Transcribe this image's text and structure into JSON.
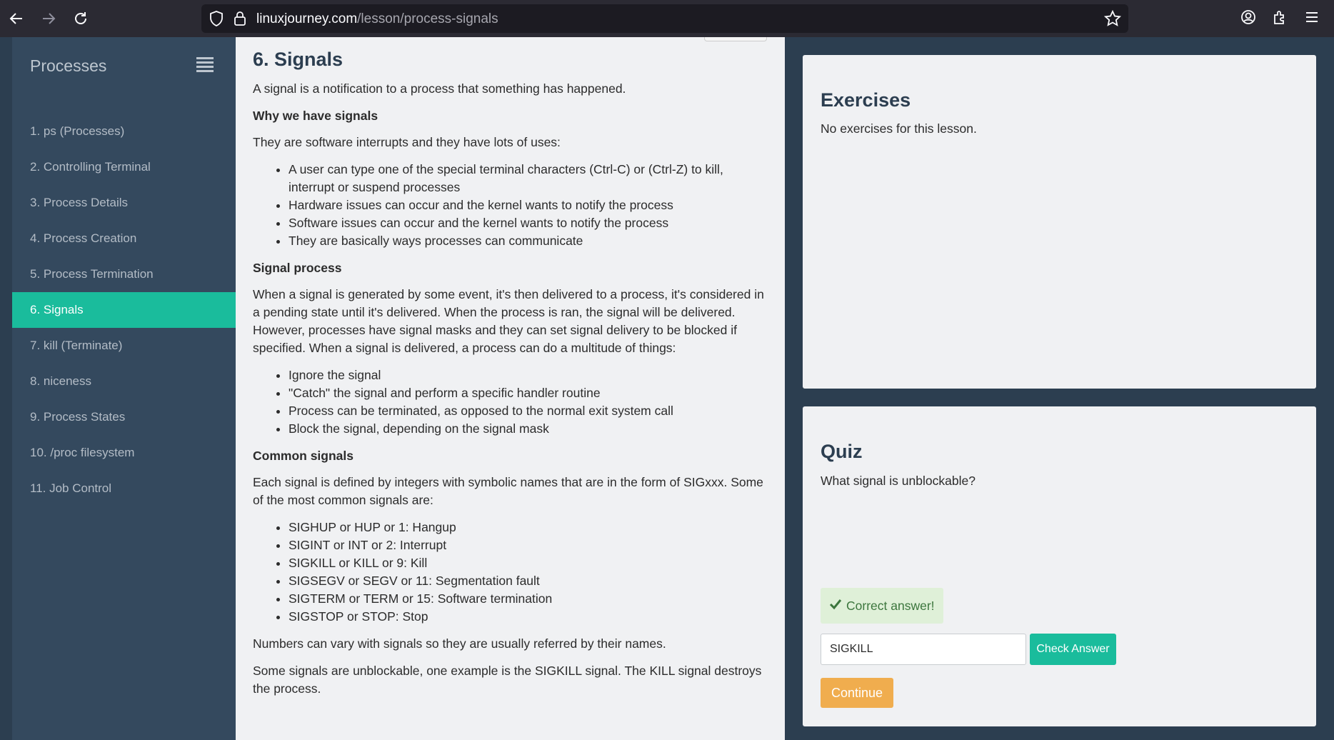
{
  "browser": {
    "url_domain": "linuxjourney.com",
    "url_path": "/lesson/process-signals",
    "icons": [
      "back-arrow-icon",
      "forward-arrow-icon",
      "reload-icon",
      "shield-icon",
      "lock-icon",
      "star-icon",
      "account-icon",
      "extensions-icon",
      "menu-icon"
    ]
  },
  "sidebar": {
    "title": "Processes",
    "items": [
      {
        "label": "1. ps (Processes)"
      },
      {
        "label": "2. Controlling Terminal"
      },
      {
        "label": "3. Process Details"
      },
      {
        "label": "4. Process Creation"
      },
      {
        "label": "5. Process Termination"
      },
      {
        "label": "6. Signals",
        "active": true
      },
      {
        "label": "7. kill (Terminate)"
      },
      {
        "label": "8. niceness"
      },
      {
        "label": "9. Process States"
      },
      {
        "label": "10. /proc filesystem"
      },
      {
        "label": "11. Job Control"
      }
    ]
  },
  "lesson": {
    "title": "6. Signals",
    "intro": "A signal is a notification to a process that something has happened.",
    "why_heading": "Why we have signals",
    "why_text": "They are software interrupts and they have lots of uses:",
    "why_list": [
      "A user can type one of the special terminal characters (Ctrl-C) or (Ctrl-Z) to kill, interrupt or suspend processes",
      "Hardware issues can occur and the kernel wants to notify the process",
      "Software issues can occur and the kernel wants to notify the process",
      "They are basically ways processes can communicate"
    ],
    "process_heading": "Signal process",
    "process_text": "When a signal is generated by some event, it's then delivered to a process, it's considered in a pending state until it's delivered. When the process is ran, the signal will be delivered. However, processes have signal masks and they can set signal delivery to be blocked if specified. When a signal is delivered, a process can do a multitude of things:",
    "process_list": [
      "Ignore the signal",
      "\"Catch\" the signal and perform a specific handler routine",
      "Process can be terminated, as opposed to the normal exit system call",
      "Block the signal, depending on the signal mask"
    ],
    "common_heading": "Common signals",
    "common_text": "Each signal is defined by integers with symbolic names that are in the form of SIGxxx. Some of the most common signals are:",
    "common_list": [
      "SIGHUP or HUP or 1: Hangup",
      "SIGINT or INT or 2: Interrupt",
      "SIGKILL or KILL or 9: Kill",
      "SIGSEGV or SEGV or 11: Segmentation fault",
      "SIGTERM or TERM or 15: Software termination",
      "SIGSTOP or STOP: Stop"
    ],
    "numbers_text": "Numbers can vary with signals so they are usually referred by their names.",
    "unblockable_text": "Some signals are unblockable, one example is the SIGKILL signal. The KILL signal destroys the process."
  },
  "exercises": {
    "title": "Exercises",
    "text": "No exercises for this lesson."
  },
  "quiz": {
    "title": "Quiz",
    "question": "What signal is unblockable?",
    "feedback": "Correct answer!",
    "answer_value": "SIGKILL",
    "check_label": "Check Answer",
    "continue_label": "Continue"
  },
  "colors": {
    "sidebar_bg": "#34495e",
    "active": "#1abc9c",
    "continue": "#f0ad4e",
    "success_bg": "#dff0d8",
    "success_text": "#3c763d"
  }
}
